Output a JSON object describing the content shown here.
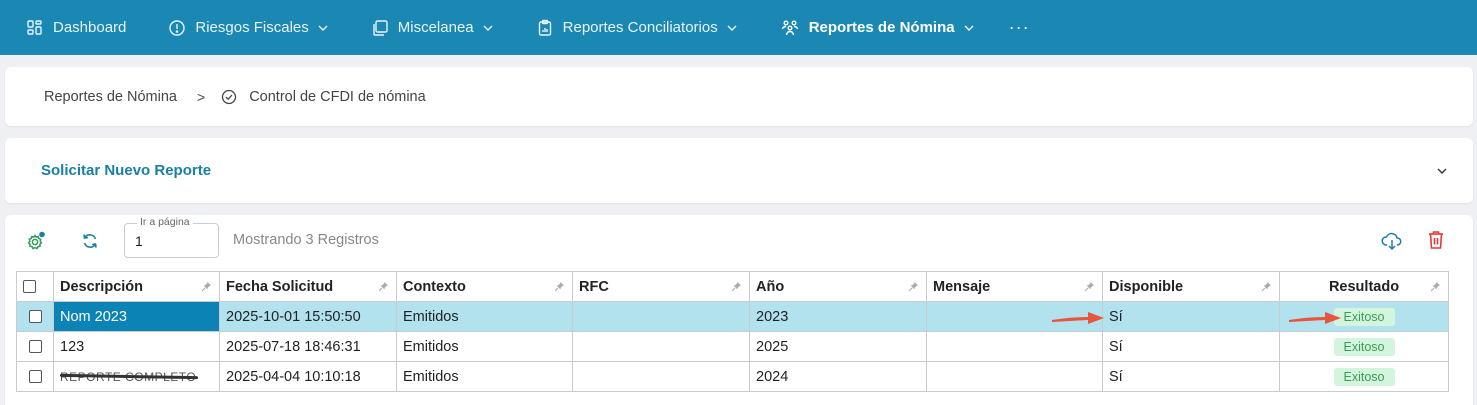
{
  "nav": {
    "items": [
      {
        "label": "Dashboard",
        "icon": "grid-icon",
        "active": false
      },
      {
        "label": "Riesgos Fiscales",
        "icon": "alert-circle-icon",
        "active": false
      },
      {
        "label": "Miscelanea",
        "icon": "copy-icon",
        "active": false
      },
      {
        "label": "Reportes Conciliatorios",
        "icon": "clipboard-icon",
        "active": false
      },
      {
        "label": "Reportes de Nómina",
        "icon": "users-icon",
        "active": true
      }
    ],
    "more": "···"
  },
  "breadcrumb": {
    "parent": "Reportes de Nómina",
    "separator": ">",
    "current": "Control de CFDI de nómina"
  },
  "request": {
    "title": "Solicitar Nuevo Reporte"
  },
  "toolbar": {
    "page_legend": "Ir a página",
    "page_value": "1",
    "showing": "Mostrando 3 Registros"
  },
  "table": {
    "columns": [
      "Descripción",
      "Fecha Solicitud",
      "Contexto",
      "RFC",
      "Año",
      "Mensaje",
      "Disponible",
      "Resultado"
    ],
    "rows": [
      {
        "descripcion": "Nom 2023",
        "fecha": "2025-10-01 15:50:50",
        "contexto": "Emitidos",
        "rfc": "",
        "anio": "2023",
        "mensaje": "",
        "disponible": "Sí",
        "resultado": "Exitoso"
      },
      {
        "descripcion": "123",
        "fecha": "2025-07-18 18:46:31",
        "contexto": "Emitidos",
        "rfc": "",
        "anio": "2025",
        "mensaje": "",
        "disponible": "Sí",
        "resultado": "Exitoso"
      },
      {
        "descripcion": "REPORTE COMPLETO",
        "fecha": "2025-04-04 10:10:18",
        "contexto": "Emitidos",
        "rfc": "",
        "anio": "2024",
        "mensaje": "",
        "disponible": "Sí",
        "resultado": "Exitoso"
      }
    ]
  },
  "colors": {
    "nav_bg": "#1a88b3",
    "accent": "#1a7fa8",
    "selected_row": "#b3e2ef",
    "selected_cell": "#0c83b5",
    "success_bg": "#d4f5dd",
    "success_text": "#3a9d55",
    "delete": "#e53935",
    "annotation_arrow": "#e8553a"
  }
}
